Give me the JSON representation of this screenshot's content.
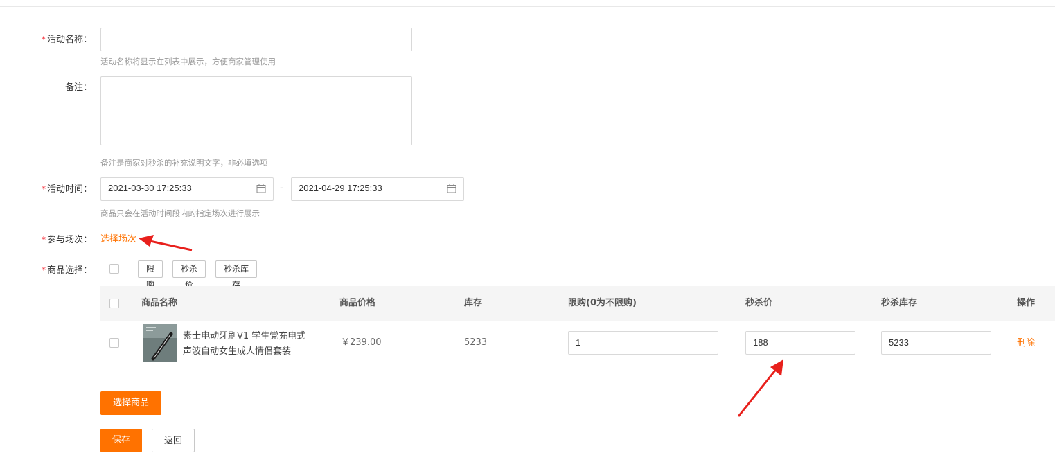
{
  "form": {
    "activity_name": {
      "label": "活动名称：",
      "required": true,
      "value": "",
      "hint": "活动名称将显示在列表中展示，方便商家管理使用"
    },
    "remark": {
      "label": "备注：",
      "required": false,
      "value": "",
      "hint": "备注是商家对秒杀的补充说明文字，非必填选项"
    },
    "activity_time": {
      "label": "活动时间：",
      "required": true,
      "start": "2021-03-30 17:25:33",
      "separator": "-",
      "end": "2021-04-29 17:25:33",
      "hint": "商品只会在活动时间段内的指定场次进行展示",
      "start_icon": "calendar-icon",
      "end_icon": "calendar-icon"
    },
    "session": {
      "label": "参与场次：",
      "required": true,
      "link": "选择场次"
    },
    "product_select": {
      "label": "商品选择：",
      "required": true,
      "batch_buttons": [
        "限购",
        "秒杀价",
        "秒杀库存"
      ]
    }
  },
  "table": {
    "headers": [
      "商品名称",
      "商品价格",
      "库存",
      "限购(0为不限购)",
      "秒杀价",
      "秒杀库存",
      "操作"
    ],
    "rows": [
      {
        "name": "素士电动牙刷V1 学生党充电式声波自动女生成人情侣套装",
        "price": "￥239.00",
        "stock": "5233",
        "limit": "1",
        "seckill_price": "188",
        "seckill_stock": "5233",
        "action": "删除"
      }
    ]
  },
  "buttons": {
    "select_product": "选择商品",
    "save": "保存",
    "back": "返回"
  },
  "colors": {
    "accent": "#ff7200",
    "required": "#f5222d",
    "annotation_arrow": "#e8201c"
  }
}
